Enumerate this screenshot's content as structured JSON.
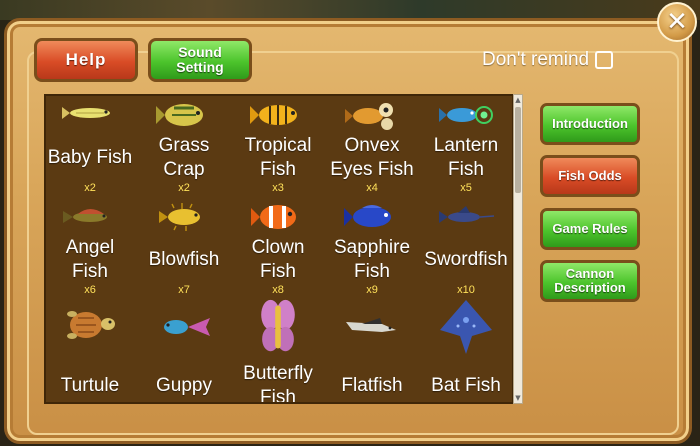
{
  "header": {
    "help_label": "Help",
    "sound_label_line1": "Sound",
    "sound_label_line2": "Setting",
    "dont_remind_label": "Don't remind",
    "close_glyph": "✕"
  },
  "side_menu": {
    "introduction": "Introduction",
    "fish_odds": "Fish Odds",
    "game_rules": "Game Rules",
    "cannon_line1": "Cannon",
    "cannon_line2": "Description"
  },
  "fish": [
    {
      "name1": "Baby Fish",
      "name2": "",
      "odds": "x2",
      "icon": "baby-fish-icon"
    },
    {
      "name1": "Grass",
      "name2": "Crap",
      "odds": "x2",
      "icon": "grass-crap-icon"
    },
    {
      "name1": "Tropical",
      "name2": "Fish",
      "odds": "x3",
      "icon": "tropical-fish-icon"
    },
    {
      "name1": "Onvex",
      "name2": "Eyes Fish",
      "odds": "x4",
      "icon": "onvex-eyes-fish-icon"
    },
    {
      "name1": "Lantern",
      "name2": "Fish",
      "odds": "x5",
      "icon": "lantern-fish-icon"
    },
    {
      "name1": "Angel",
      "name2": "Fish",
      "odds": "x6",
      "icon": "angel-fish-icon"
    },
    {
      "name1": "Blowfish",
      "name2": "",
      "odds": "x7",
      "icon": "blowfish-icon"
    },
    {
      "name1": "Clown",
      "name2": "Fish",
      "odds": "x8",
      "icon": "clown-fish-icon"
    },
    {
      "name1": "Sapphire",
      "name2": "Fish",
      "odds": "x9",
      "icon": "sapphire-fish-icon"
    },
    {
      "name1": "Swordfish",
      "name2": "",
      "odds": "x10",
      "icon": "swordfish-icon"
    },
    {
      "name1": "Turtule",
      "name2": "",
      "odds": "",
      "icon": "turtle-icon"
    },
    {
      "name1": "Guppy",
      "name2": "",
      "odds": "",
      "icon": "guppy-icon"
    },
    {
      "name1": "Butterfly",
      "name2": "Fish",
      "odds": "",
      "icon": "butterfly-fish-icon"
    },
    {
      "name1": "Flatfish",
      "name2": "",
      "odds": "",
      "icon": "flatfish-icon"
    },
    {
      "name1": "Bat Fish",
      "name2": "",
      "odds": "",
      "icon": "bat-fish-icon"
    }
  ],
  "colors": {
    "panel": "#d9a65a",
    "grid_bg": "#5b3a12",
    "odds_text": "#ffe15a",
    "button_red": "#d94c26",
    "button_green": "#4cc42c"
  }
}
